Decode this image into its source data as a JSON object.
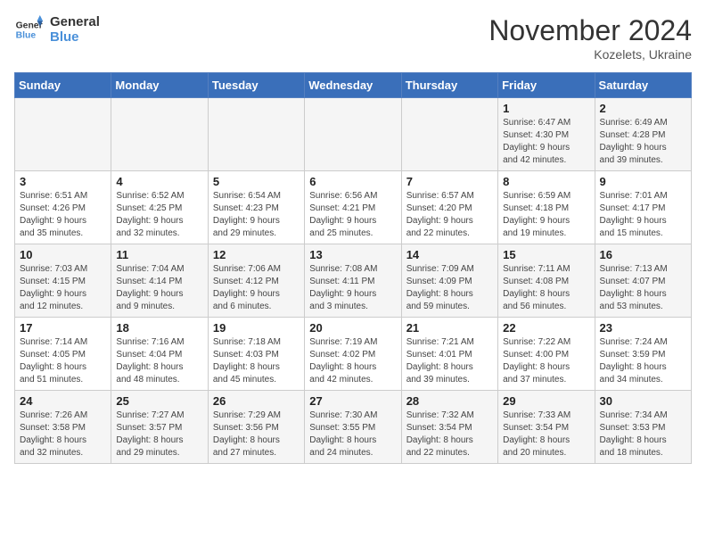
{
  "logo": {
    "line1": "General",
    "line2": "Blue"
  },
  "title": "November 2024",
  "location": "Kozelets, Ukraine",
  "days_of_week": [
    "Sunday",
    "Monday",
    "Tuesday",
    "Wednesday",
    "Thursday",
    "Friday",
    "Saturday"
  ],
  "weeks": [
    [
      {
        "day": "",
        "info": ""
      },
      {
        "day": "",
        "info": ""
      },
      {
        "day": "",
        "info": ""
      },
      {
        "day": "",
        "info": ""
      },
      {
        "day": "",
        "info": ""
      },
      {
        "day": "1",
        "info": "Sunrise: 6:47 AM\nSunset: 4:30 PM\nDaylight: 9 hours\nand 42 minutes."
      },
      {
        "day": "2",
        "info": "Sunrise: 6:49 AM\nSunset: 4:28 PM\nDaylight: 9 hours\nand 39 minutes."
      }
    ],
    [
      {
        "day": "3",
        "info": "Sunrise: 6:51 AM\nSunset: 4:26 PM\nDaylight: 9 hours\nand 35 minutes."
      },
      {
        "day": "4",
        "info": "Sunrise: 6:52 AM\nSunset: 4:25 PM\nDaylight: 9 hours\nand 32 minutes."
      },
      {
        "day": "5",
        "info": "Sunrise: 6:54 AM\nSunset: 4:23 PM\nDaylight: 9 hours\nand 29 minutes."
      },
      {
        "day": "6",
        "info": "Sunrise: 6:56 AM\nSunset: 4:21 PM\nDaylight: 9 hours\nand 25 minutes."
      },
      {
        "day": "7",
        "info": "Sunrise: 6:57 AM\nSunset: 4:20 PM\nDaylight: 9 hours\nand 22 minutes."
      },
      {
        "day": "8",
        "info": "Sunrise: 6:59 AM\nSunset: 4:18 PM\nDaylight: 9 hours\nand 19 minutes."
      },
      {
        "day": "9",
        "info": "Sunrise: 7:01 AM\nSunset: 4:17 PM\nDaylight: 9 hours\nand 15 minutes."
      }
    ],
    [
      {
        "day": "10",
        "info": "Sunrise: 7:03 AM\nSunset: 4:15 PM\nDaylight: 9 hours\nand 12 minutes."
      },
      {
        "day": "11",
        "info": "Sunrise: 7:04 AM\nSunset: 4:14 PM\nDaylight: 9 hours\nand 9 minutes."
      },
      {
        "day": "12",
        "info": "Sunrise: 7:06 AM\nSunset: 4:12 PM\nDaylight: 9 hours\nand 6 minutes."
      },
      {
        "day": "13",
        "info": "Sunrise: 7:08 AM\nSunset: 4:11 PM\nDaylight: 9 hours\nand 3 minutes."
      },
      {
        "day": "14",
        "info": "Sunrise: 7:09 AM\nSunset: 4:09 PM\nDaylight: 8 hours\nand 59 minutes."
      },
      {
        "day": "15",
        "info": "Sunrise: 7:11 AM\nSunset: 4:08 PM\nDaylight: 8 hours\nand 56 minutes."
      },
      {
        "day": "16",
        "info": "Sunrise: 7:13 AM\nSunset: 4:07 PM\nDaylight: 8 hours\nand 53 minutes."
      }
    ],
    [
      {
        "day": "17",
        "info": "Sunrise: 7:14 AM\nSunset: 4:05 PM\nDaylight: 8 hours\nand 51 minutes."
      },
      {
        "day": "18",
        "info": "Sunrise: 7:16 AM\nSunset: 4:04 PM\nDaylight: 8 hours\nand 48 minutes."
      },
      {
        "day": "19",
        "info": "Sunrise: 7:18 AM\nSunset: 4:03 PM\nDaylight: 8 hours\nand 45 minutes."
      },
      {
        "day": "20",
        "info": "Sunrise: 7:19 AM\nSunset: 4:02 PM\nDaylight: 8 hours\nand 42 minutes."
      },
      {
        "day": "21",
        "info": "Sunrise: 7:21 AM\nSunset: 4:01 PM\nDaylight: 8 hours\nand 39 minutes."
      },
      {
        "day": "22",
        "info": "Sunrise: 7:22 AM\nSunset: 4:00 PM\nDaylight: 8 hours\nand 37 minutes."
      },
      {
        "day": "23",
        "info": "Sunrise: 7:24 AM\nSunset: 3:59 PM\nDaylight: 8 hours\nand 34 minutes."
      }
    ],
    [
      {
        "day": "24",
        "info": "Sunrise: 7:26 AM\nSunset: 3:58 PM\nDaylight: 8 hours\nand 32 minutes."
      },
      {
        "day": "25",
        "info": "Sunrise: 7:27 AM\nSunset: 3:57 PM\nDaylight: 8 hours\nand 29 minutes."
      },
      {
        "day": "26",
        "info": "Sunrise: 7:29 AM\nSunset: 3:56 PM\nDaylight: 8 hours\nand 27 minutes."
      },
      {
        "day": "27",
        "info": "Sunrise: 7:30 AM\nSunset: 3:55 PM\nDaylight: 8 hours\nand 24 minutes."
      },
      {
        "day": "28",
        "info": "Sunrise: 7:32 AM\nSunset: 3:54 PM\nDaylight: 8 hours\nand 22 minutes."
      },
      {
        "day": "29",
        "info": "Sunrise: 7:33 AM\nSunset: 3:54 PM\nDaylight: 8 hours\nand 20 minutes."
      },
      {
        "day": "30",
        "info": "Sunrise: 7:34 AM\nSunset: 3:53 PM\nDaylight: 8 hours\nand 18 minutes."
      }
    ]
  ]
}
